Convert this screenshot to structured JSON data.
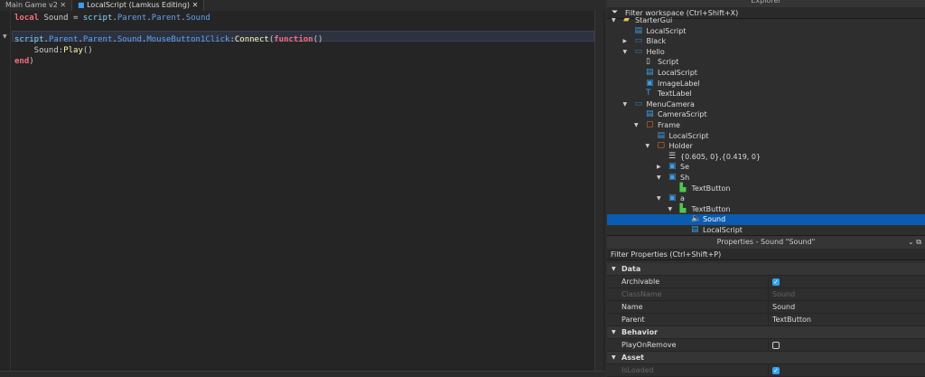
{
  "tabs": [
    {
      "label": "Main Game v2",
      "close": "✕"
    },
    {
      "label": "LocalScript (Lamkus Editing)",
      "close": "✕"
    }
  ],
  "code": {
    "lines": [
      [
        {
          "t": "local",
          "c": "kw"
        },
        {
          "t": " Sound = "
        },
        {
          "t": "script",
          "c": "id"
        },
        {
          "t": "."
        },
        {
          "t": "Parent",
          "c": "pr"
        },
        {
          "t": "."
        },
        {
          "t": "Parent",
          "c": "pr"
        },
        {
          "t": "."
        },
        {
          "t": "Sound",
          "c": "pr"
        }
      ],
      [],
      [
        {
          "t": "script",
          "c": "id"
        },
        {
          "t": "."
        },
        {
          "t": "Parent",
          "c": "pr"
        },
        {
          "t": "."
        },
        {
          "t": "Parent",
          "c": "pr"
        },
        {
          "t": "."
        },
        {
          "t": "Sound",
          "c": "pr"
        },
        {
          "t": "."
        },
        {
          "t": "MouseButton1Click",
          "c": "pr"
        },
        {
          "t": ":"
        },
        {
          "t": "Connect",
          "c": "fn"
        },
        {
          "t": "("
        },
        {
          "t": "function",
          "c": "kw"
        },
        {
          "t": "()"
        }
      ],
      [
        {
          "t": "    Sound:"
        },
        {
          "t": "Play",
          "c": "fn"
        },
        {
          "t": "()"
        }
      ],
      [
        {
          "t": "end",
          "c": "kw"
        },
        {
          "t": ")"
        }
      ]
    ]
  },
  "explorer": {
    "title": "Explorer",
    "filter": "Filter workspace (Ctrl+Shift+X)",
    "items": [
      {
        "label": "StarterGui",
        "depth": 0,
        "arrow": "down",
        "icon": "folder-gui",
        "color": "#e8c15a"
      },
      {
        "label": "LocalScript",
        "depth": 1,
        "arrow": "",
        "icon": "localscript",
        "color": "#3aa0e8"
      },
      {
        "label": "Black",
        "depth": 1,
        "arrow": "right",
        "icon": "screengui",
        "color": "#3a7fb8"
      },
      {
        "label": "Hello",
        "depth": 1,
        "arrow": "down",
        "icon": "screengui",
        "color": "#3a7fb8"
      },
      {
        "label": "Script",
        "depth": 2,
        "arrow": "",
        "icon": "script",
        "color": "#d8d8d8"
      },
      {
        "label": "LocalScript",
        "depth": 2,
        "arrow": "",
        "icon": "localscript",
        "color": "#3aa0e8"
      },
      {
        "label": "ImageLabel",
        "depth": 2,
        "arrow": "",
        "icon": "imagelabel",
        "color": "#3aa0e8"
      },
      {
        "label": "TextLabel",
        "depth": 2,
        "arrow": "",
        "icon": "textlabel",
        "color": "#3aa0e8"
      },
      {
        "label": "MenuCamera",
        "depth": 1,
        "arrow": "down",
        "icon": "screengui",
        "color": "#3a7fb8"
      },
      {
        "label": "CameraScript",
        "depth": 2,
        "arrow": "",
        "icon": "localscript",
        "color": "#3aa0e8"
      },
      {
        "label": "Frame",
        "depth": 2,
        "arrow": "down",
        "icon": "frame",
        "color": "#e8742a"
      },
      {
        "label": "LocalScript",
        "depth": 3,
        "arrow": "",
        "icon": "localscript",
        "color": "#3aa0e8"
      },
      {
        "label": "Holder",
        "depth": 3,
        "arrow": "down",
        "icon": "frame",
        "color": "#e8742a"
      },
      {
        "label": "{0.605, 0},{0.419, 0}",
        "depth": 4,
        "arrow": "",
        "icon": "list-layout",
        "color": "#dddddd"
      },
      {
        "label": "Se",
        "depth": 4,
        "arrow": "right",
        "icon": "imagebutton",
        "color": "#3aa0e8"
      },
      {
        "label": "Sh",
        "depth": 4,
        "arrow": "down",
        "icon": "imagebutton",
        "color": "#3aa0e8"
      },
      {
        "label": "TextButton",
        "depth": 5,
        "arrow": "",
        "icon": "textbutton",
        "color": "#4ec94e"
      },
      {
        "label": "a",
        "depth": 4,
        "arrow": "down",
        "icon": "imagebutton",
        "color": "#3aa0e8"
      },
      {
        "label": "TextButton",
        "depth": 5,
        "arrow": "down",
        "icon": "textbutton",
        "color": "#4ec94e"
      },
      {
        "label": "Sound",
        "depth": 6,
        "arrow": "",
        "icon": "sound",
        "color": "#ffffff",
        "selected": true
      },
      {
        "label": "LocalScript",
        "depth": 6,
        "arrow": "",
        "icon": "localscript",
        "color": "#3aa0e8"
      }
    ]
  },
  "properties": {
    "title": "Properties - Sound \"Sound\"",
    "filter": "Filter Properties (Ctrl+Shift+P)",
    "rows": [
      {
        "cat": "Data"
      },
      {
        "name": "Archivable",
        "check": true
      },
      {
        "name": "ClassName",
        "value": "Sound",
        "disabled": true
      },
      {
        "name": "Name",
        "value": "Sound"
      },
      {
        "name": "Parent",
        "value": "TextButton"
      },
      {
        "cat": "Behavior"
      },
      {
        "name": "PlayOnRemove",
        "check": false
      },
      {
        "cat": "Asset"
      },
      {
        "name": "IsLoaded",
        "check": true,
        "disabled": true
      }
    ]
  }
}
